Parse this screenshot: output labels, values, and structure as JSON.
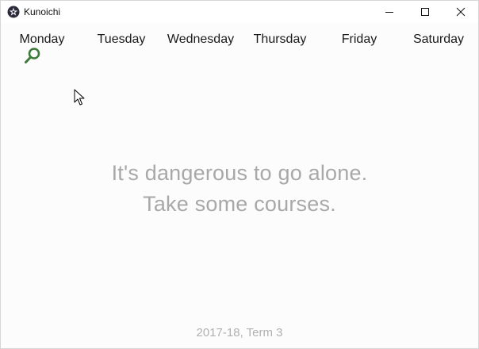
{
  "window": {
    "title": "Kunoichi",
    "controls": {
      "minimize_icon": "minimize-icon",
      "maximize_icon": "maximize-icon",
      "close_icon": "close-icon"
    }
  },
  "days": [
    {
      "label": "Monday"
    },
    {
      "label": "Tuesday"
    },
    {
      "label": "Wednesday"
    },
    {
      "label": "Thursday"
    },
    {
      "label": "Friday"
    },
    {
      "label": "Saturday"
    }
  ],
  "search": {
    "icon": "search-icon",
    "color": "#3d7a3a"
  },
  "empty_state": {
    "line1": "It's dangerous to go alone.",
    "line2": "Take some courses."
  },
  "term": "2017-18, Term 3"
}
